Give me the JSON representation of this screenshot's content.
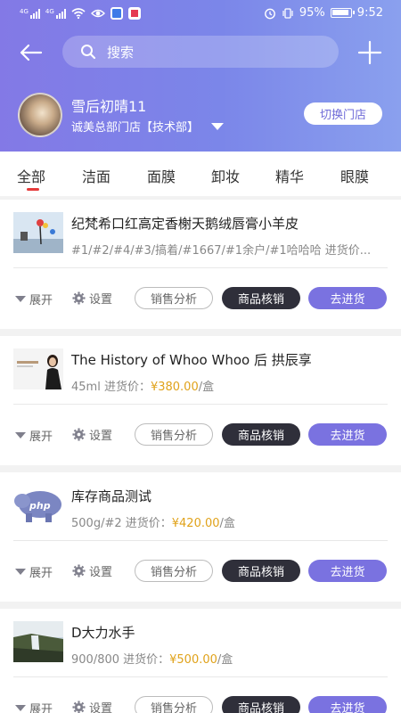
{
  "status_bar": {
    "signal1_label": "4G",
    "signal2_label": "4G",
    "battery_percent": "95%",
    "time": "9:52"
  },
  "header": {
    "search_placeholder": "搜索",
    "user_name": "雪后初晴11",
    "store_name": "诚美总部门店【技术部】",
    "switch_store_label": "切换门店"
  },
  "tabs": [
    {
      "label": "全部"
    },
    {
      "label": "洁面"
    },
    {
      "label": "面膜"
    },
    {
      "label": "卸妆"
    },
    {
      "label": "精华"
    },
    {
      "label": "眼膜"
    }
  ],
  "actions": {
    "expand": "展开",
    "setting": "设置",
    "sales_analysis": "销售分析",
    "verify": "商品核销",
    "restock": "去进货"
  },
  "products": [
    {
      "title": "纪梵希口红高定香榭天鹅绒唇膏小羊皮",
      "spec": "#1/#2/#4/#3/搞着/#1667/#1余户/#1哈哈哈 进货价...",
      "price": "",
      "unit": ""
    },
    {
      "title": "The History of Whoo Whoo 后 拱辰享",
      "spec": "45ml 进货价：",
      "price": "¥380.00",
      "unit": "/盒"
    },
    {
      "title": "库存商品测试",
      "spec": "500g/#2 进货价：",
      "price": "¥420.00",
      "unit": "/盒"
    },
    {
      "title": "D大力水手",
      "spec": "900/800 进货价：",
      "price": "¥500.00",
      "unit": "/盒"
    }
  ],
  "colors": {
    "header_gradient_start": "#8379e6",
    "header_gradient_end": "#8aa0ee",
    "price": "#e0a21a",
    "verify_button": "#2f2f3a",
    "restock_button": "#7a72e0",
    "tab_indicator": "#e53a3a"
  }
}
